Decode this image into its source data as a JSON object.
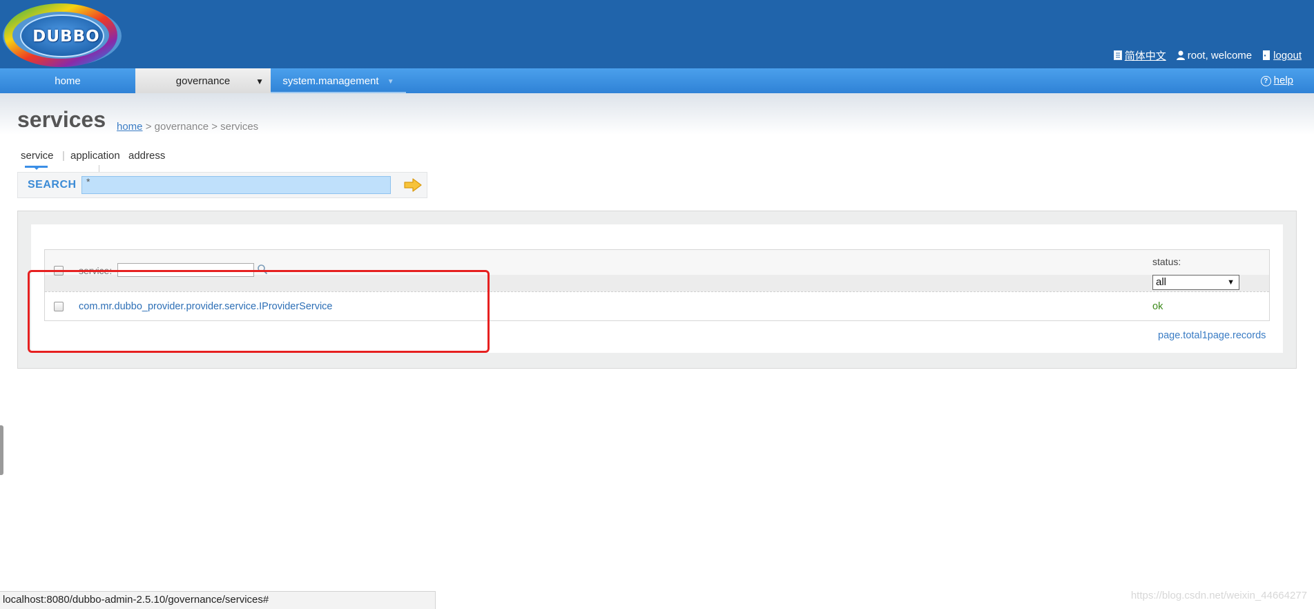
{
  "header": {
    "logo_text": "DUBBO",
    "language_label": "简体中文",
    "user_text": "root, welcome",
    "logout_label": "logout"
  },
  "nav": {
    "tabs": [
      {
        "label": "home"
      },
      {
        "label": "governance",
        "active": true
      },
      {
        "label": "system.management"
      }
    ],
    "help_label": "help"
  },
  "page": {
    "title": "services",
    "breadcrumb": {
      "home": "home",
      "separator": ">",
      "governance": "governance",
      "current": "services"
    },
    "tabs": [
      "service",
      "application",
      "address"
    ],
    "tab_separator": "|"
  },
  "search": {
    "label": "SEARCH",
    "value": "*"
  },
  "table": {
    "service_filter_label": "service:",
    "status_label": "status:",
    "status_filter_value": "all",
    "rows": [
      {
        "service": "com.mr.dubbo_provider.provider.service.IProviderService",
        "status": "ok"
      }
    ],
    "pager": "page.total1page.records"
  },
  "browser": {
    "status_url": "localhost:8080/dubbo-admin-2.5.10/governance/services#",
    "watermark": "https://blog.csdn.net/weixin_44664277"
  },
  "colors": {
    "header_bg": "#2064ab",
    "nav_bg": "#3a8ee6",
    "link": "#2d6fb6",
    "status_ok": "#3c8a1b",
    "highlight": "#e62020"
  }
}
